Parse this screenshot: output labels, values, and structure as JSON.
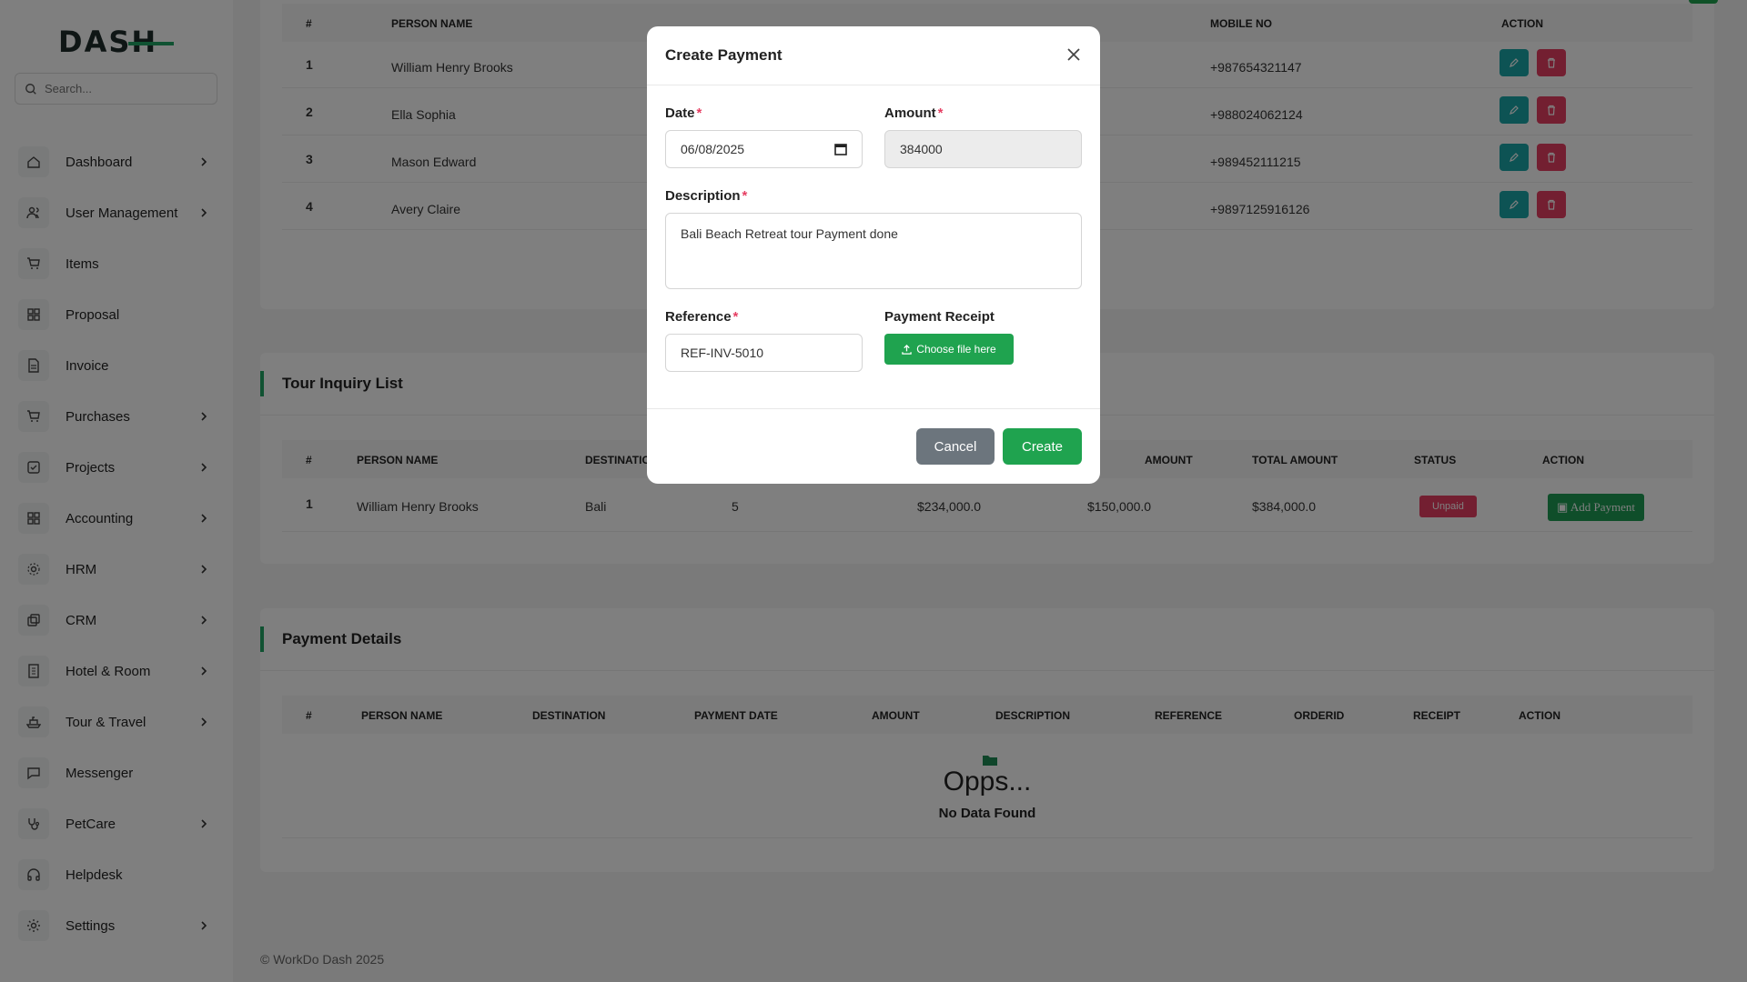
{
  "brand": {
    "logo_text": "DASH"
  },
  "search": {
    "placeholder": "Search..."
  },
  "sidebar": {
    "items": [
      {
        "label": "Dashboard",
        "icon": "home-icon",
        "chevron": true
      },
      {
        "label": "User Management",
        "icon": "users-icon",
        "chevron": true
      },
      {
        "label": "Items",
        "icon": "cart-icon",
        "chevron": false
      },
      {
        "label": "Proposal",
        "icon": "grid-icon",
        "chevron": false
      },
      {
        "label": "Invoice",
        "icon": "file-icon",
        "chevron": false
      },
      {
        "label": "Purchases",
        "icon": "cart-icon",
        "chevron": true
      },
      {
        "label": "Projects",
        "icon": "check-square-icon",
        "chevron": true
      },
      {
        "label": "Accounting",
        "icon": "grid-icon",
        "chevron": true
      },
      {
        "label": "HRM",
        "icon": "settings-icon",
        "chevron": true
      },
      {
        "label": "CRM",
        "icon": "layers-icon",
        "chevron": true
      },
      {
        "label": "Hotel & Room",
        "icon": "building-icon",
        "chevron": true
      },
      {
        "label": "Tour & Travel",
        "icon": "ship-icon",
        "chevron": true
      },
      {
        "label": "Messenger",
        "icon": "message-icon",
        "chevron": false
      },
      {
        "label": "PetCare",
        "icon": "stethoscope-icon",
        "chevron": true
      },
      {
        "label": "Helpdesk",
        "icon": "headphones-icon",
        "chevron": false
      },
      {
        "label": "Settings",
        "icon": "gear-icon",
        "chevron": true
      }
    ]
  },
  "persons_table": {
    "headers": [
      "#",
      "PERSON NAME",
      "MOBILE NO",
      "ACTION"
    ],
    "rows": [
      {
        "num": "1",
        "name": "William Henry Brooks",
        "mobile": "+987654321147"
      },
      {
        "num": "2",
        "name": "Ella Sophia",
        "mobile": "+988024062124"
      },
      {
        "num": "3",
        "name": "Mason Edward",
        "mobile": "+989452111215"
      },
      {
        "num": "4",
        "name": "Avery Claire",
        "mobile": "+9897125916126"
      }
    ]
  },
  "tour_inquiry": {
    "title": "Tour Inquiry List",
    "headers": [
      "#",
      "PERSON NAME",
      "DESTINATIC",
      "AMOUNT",
      "TOTAL AMOUNT",
      "STATUS",
      "ACTION"
    ],
    "rows": [
      {
        "num": "1",
        "name": "William Henry Brooks",
        "destination": "Bali",
        "persons": "5",
        "amount1": "$234,000.0",
        "amount2": "$150,000.0",
        "total": "$384,000.0",
        "status": "Unpaid",
        "action": "Add Payment"
      }
    ]
  },
  "payment_details": {
    "title": "Payment Details",
    "headers": [
      "#",
      "PERSON NAME",
      "DESTINATION",
      "PAYMENT DATE",
      "AMOUNT",
      "DESCRIPTION",
      "REFERENCE",
      "ORDERID",
      "RECEIPT",
      "ACTION"
    ],
    "empty_title": "Opps...",
    "empty_text": "No Data Found"
  },
  "footer": {
    "text": "© WorkDo Dash 2025"
  },
  "modal": {
    "title": "Create Payment",
    "date_label": "Date",
    "date_value": "06/08/2025",
    "amount_label": "Amount",
    "amount_value": "384000",
    "description_label": "Description",
    "description_value": "Bali Beach Retreat tour Payment done",
    "reference_label": "Reference",
    "reference_value": "REF-INV-5010",
    "receipt_label": "Payment Receipt",
    "choose_file": "Choose file here",
    "cancel": "Cancel",
    "create": "Create",
    "required_mark": "*"
  },
  "colors": {
    "accent": "#20a464",
    "danger": "#e63e62",
    "teal": "#1aa7a8",
    "secondary": "#6c757d"
  }
}
